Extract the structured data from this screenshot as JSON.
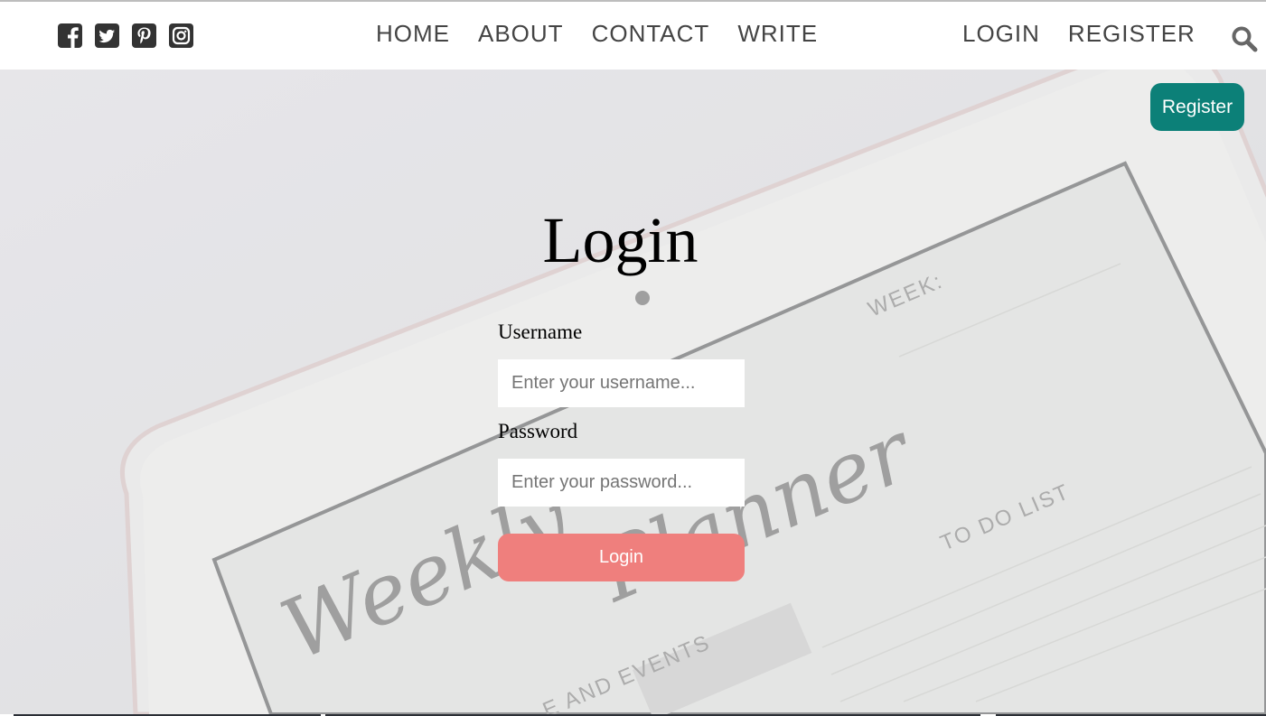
{
  "social": [
    {
      "icon": "facebook-icon"
    },
    {
      "icon": "twitter-icon"
    },
    {
      "icon": "pinterest-icon"
    },
    {
      "icon": "instagram-icon"
    }
  ],
  "nav": {
    "home": "HOME",
    "about": "ABOUT",
    "contact": "CONTACT",
    "write": "WRITE",
    "login": "LOGIN",
    "register": "REGISTER",
    "search_icon": "search-icon"
  },
  "hero": {
    "register_button": "Register",
    "background_text": {
      "planner": "Weekly Planner",
      "week": "WEEK:",
      "todo": "TO DO LIST",
      "events": "E AND EVENTS"
    }
  },
  "form": {
    "title": "Login",
    "username_label": "Username",
    "username_placeholder": "Enter your username...",
    "password_label": "Password",
    "password_placeholder": "Enter your password...",
    "submit_label": "Login"
  },
  "colors": {
    "accent_register": "#0c8078",
    "accent_login": "#ef7f7d",
    "nav_text": "#444444"
  }
}
